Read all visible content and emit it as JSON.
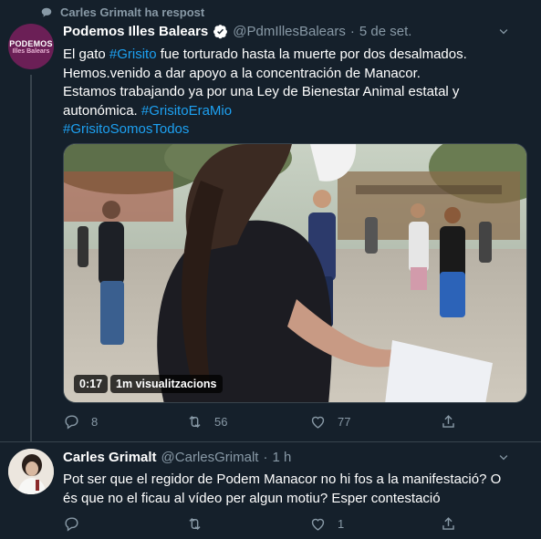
{
  "retweet": {
    "label": "Carles Grimalt ha respost"
  },
  "tweet1": {
    "avatar_line1": "PODEMOS",
    "avatar_line2": "Illes Balears",
    "name": "Podemos Illes Balears",
    "handle": "@PdmIllesBalears",
    "dot": "·",
    "time": "5 de set.",
    "text_parts": [
      "El gato ",
      "#Grisito",
      " fue torturado hasta la muerte por dos desalmados.",
      "Hemos.venido a dar apoyo a la concentración de Manacor.",
      "Estamos trabajando ya por una Ley de Bienestar Animal estatal y autonómica. ",
      "#GrisitoEraMio",
      "#GrisitoSomosTodos"
    ],
    "video": {
      "duration": "0:17",
      "views": "1m visualitzacions"
    },
    "actions": {
      "replies": "8",
      "retweets": "56",
      "likes": "77"
    }
  },
  "tweet2": {
    "name": "Carles Grimalt",
    "handle": "@CarlesGrimalt",
    "dot": "·",
    "time": "1 h",
    "text": "Pot ser que el regidor de Podem Manacor no hi fos a la manifestació? O és que no el ficau al vídeo per algun motiu? Esper contestació",
    "actions": {
      "replies": "",
      "retweets": "",
      "likes": "1"
    }
  },
  "icons": {
    "retweet_context": "speech-bubble-icon",
    "verified": "verified-badge-icon",
    "more": "chevron-down-icon",
    "reply": "reply-icon",
    "retweet": "retweet-icon",
    "like": "heart-icon",
    "share": "share-icon"
  },
  "colors": {
    "background": "#15202b",
    "accent": "#1da1f2",
    "muted": "#8899a6",
    "divider": "#38444d",
    "brand": "#6b1f56"
  }
}
